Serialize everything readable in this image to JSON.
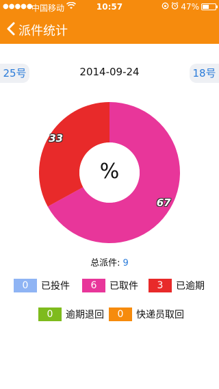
{
  "status_bar": {
    "signal": "●●●●●",
    "carrier": "中国移动",
    "time": "10:57",
    "battery": "47%"
  },
  "nav": {
    "title": "派件统计"
  },
  "date_nav": {
    "prev": "25号",
    "date": "2014-09-24",
    "next": "18号"
  },
  "chart_data": {
    "type": "pie",
    "center_label": "%",
    "slices": [
      {
        "value": 67,
        "label": "67",
        "color": "#e8369a"
      },
      {
        "value": 33,
        "label": "33",
        "color": "#e82a2a"
      }
    ]
  },
  "total": {
    "label": "总派件:",
    "value": "9"
  },
  "legend": [
    {
      "count": "0",
      "label": "已投件",
      "color": "#8fb4f4"
    },
    {
      "count": "6",
      "label": "已取件",
      "color": "#e8369a"
    },
    {
      "count": "3",
      "label": "已逾期",
      "color": "#e82a2a"
    },
    {
      "count": "0",
      "label": "逾期退回",
      "color": "#7ebb1d"
    },
    {
      "count": "0",
      "label": "快递员取回",
      "color": "#f68b0d"
    }
  ]
}
